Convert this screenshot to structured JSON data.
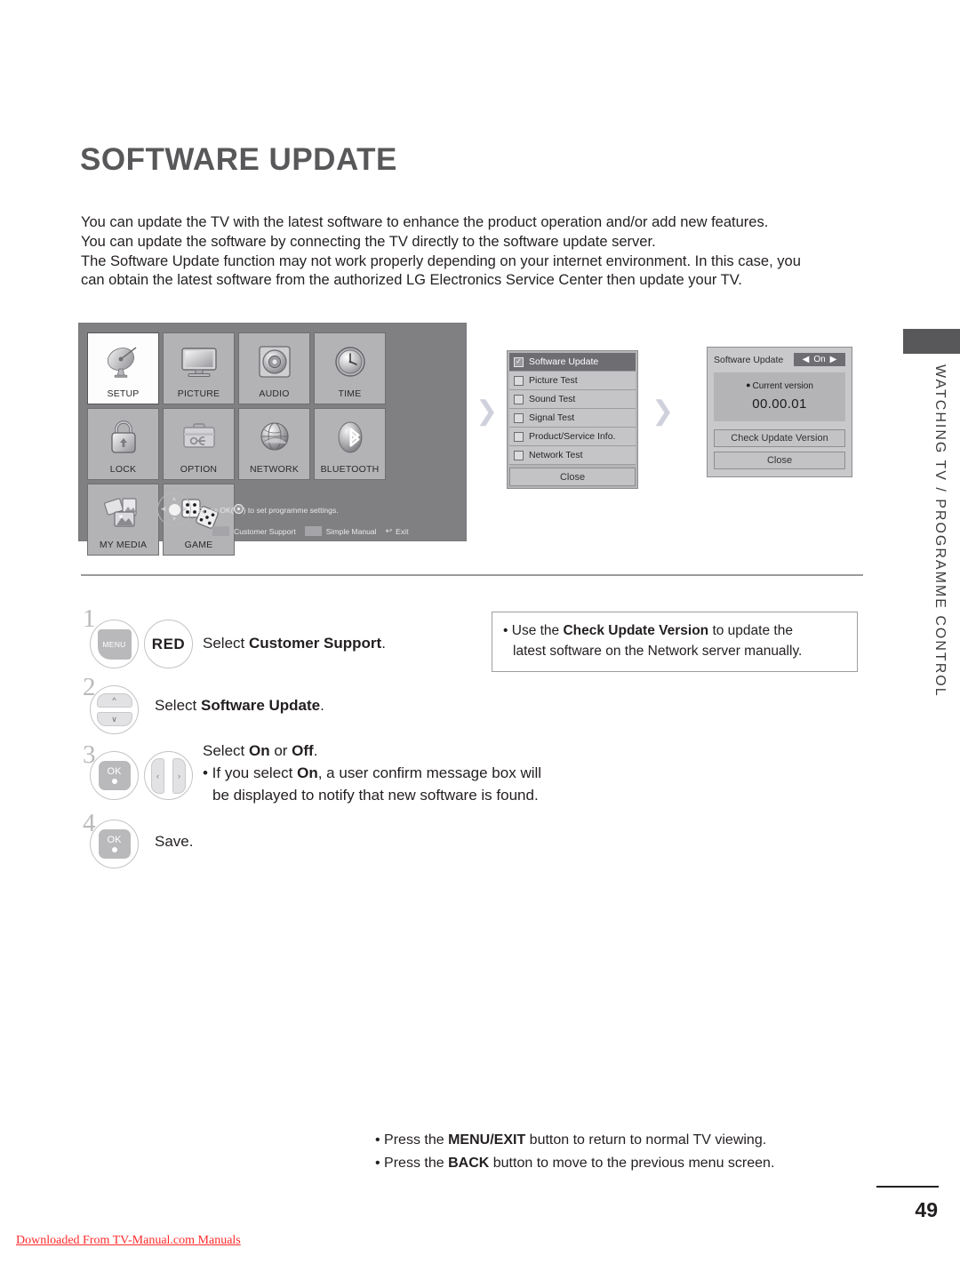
{
  "page": {
    "title": "SOFTWARE UPDATE",
    "number": "49",
    "chapter_label": "WATCHING TV / PROGRAMME CONTROL",
    "watermark": "Downloaded From TV-Manual.com Manuals"
  },
  "intro": {
    "line1": "You can update the TV with the latest software to enhance the product operation and/or add new features.",
    "line2": "You can update the software by connecting the TV directly to the software update server.",
    "line3": "The Software Update function may not work properly depending on your internet environment. In this case, you",
    "line4": "can obtain the latest software from the authorized LG Electronics Service Center then update your TV."
  },
  "osd_main_menu": {
    "tiles": [
      {
        "label": "SETUP",
        "icon": "satellite-dish-icon",
        "selected": true
      },
      {
        "label": "PICTURE",
        "icon": "monitor-icon",
        "selected": false
      },
      {
        "label": "AUDIO",
        "icon": "speaker-icon",
        "selected": false
      },
      {
        "label": "TIME",
        "icon": "clock-icon",
        "selected": false
      },
      {
        "label": "LOCK",
        "icon": "padlock-icon",
        "selected": false
      },
      {
        "label": "OPTION",
        "icon": "toolbox-icon",
        "selected": false
      },
      {
        "label": "NETWORK",
        "icon": "globe-icon",
        "selected": false
      },
      {
        "label": "BLUETOOTH",
        "icon": "bluetooth-icon",
        "selected": false
      },
      {
        "label": "MY MEDIA",
        "icon": "media-photos-icon",
        "selected": false
      },
      {
        "label": "GAME",
        "icon": "dice-icon",
        "selected": false
      }
    ],
    "help_text_before": "Press OK(",
    "help_text_after": ") to set programme settings.",
    "footer_customer_support": "Customer Support",
    "footer_simple_manual": "Simple Manual",
    "footer_exit": "Exit",
    "exit_icon": "return-arrow-icon"
  },
  "osd_list_panel": {
    "rows": [
      {
        "label": "Software Update",
        "checked": true,
        "active": true
      },
      {
        "label": "Picture Test",
        "checked": false,
        "active": false
      },
      {
        "label": "Sound Test",
        "checked": false,
        "active": false
      },
      {
        "label": "Signal Test",
        "checked": false,
        "active": false
      },
      {
        "label": "Product/Service Info.",
        "checked": false,
        "active": false
      },
      {
        "label": "Network Test",
        "checked": false,
        "active": false
      }
    ],
    "close_label": "Close"
  },
  "osd_version_panel": {
    "title": "Software Update",
    "toggle_value": "On",
    "toggle_left_icon": "arrow-left-icon",
    "toggle_right_icon": "arrow-right-icon",
    "current_version_label": "Current version",
    "version_value": "00.00.01",
    "check_button": "Check Update Version",
    "close_button": "Close"
  },
  "steps": [
    {
      "number": "1",
      "keys": [
        "MENU",
        "RED"
      ],
      "text_plain_1": "Select ",
      "text_bold_1": "Customer Support",
      "text_plain_2": "."
    },
    {
      "number": "2",
      "keys": [
        "up-down"
      ],
      "text_plain_1": "Select ",
      "text_bold_1": "Software Update",
      "text_plain_2": "."
    },
    {
      "number": "3",
      "keys": [
        "OK",
        "left-right"
      ],
      "line1_plain_1": "Select ",
      "line1_bold_1": "On",
      "line1_plain_2": " or ",
      "line1_bold_2": "Off",
      "line1_plain_3": ".",
      "line2_bullet": "•",
      "line2_plain_1": " If you select ",
      "line2_bold_1": "On",
      "line2_plain_2": ", a user confirm message box will",
      "line3": "be displayed to notify that new software is found."
    },
    {
      "number": "4",
      "keys": [
        "OK"
      ],
      "text_plain_1": "Save."
    }
  ],
  "callout": {
    "bullet": "•",
    "plain_1": " Use the ",
    "bold_1": "Check Update Version",
    "plain_2": " to update the",
    "line2": "latest software on the Network server manually."
  },
  "bottom_notes": {
    "line1_bullet": "•",
    "line1_plain_1": " Press the ",
    "line1_bold": "MENU/EXIT",
    "line1_plain_2": " button to return to normal TV viewing.",
    "line2_bullet": "•",
    "line2_plain_1": " Press the ",
    "line2_bold": "BACK",
    "line2_plain_2": " button to move to the previous menu screen."
  },
  "colors": {
    "title_gray": "#58585a",
    "osd_background": "#808083",
    "tile_gray": "#b3b3b6",
    "active_row": "#6e6e72",
    "watermark_red": "#ff2a2a"
  }
}
